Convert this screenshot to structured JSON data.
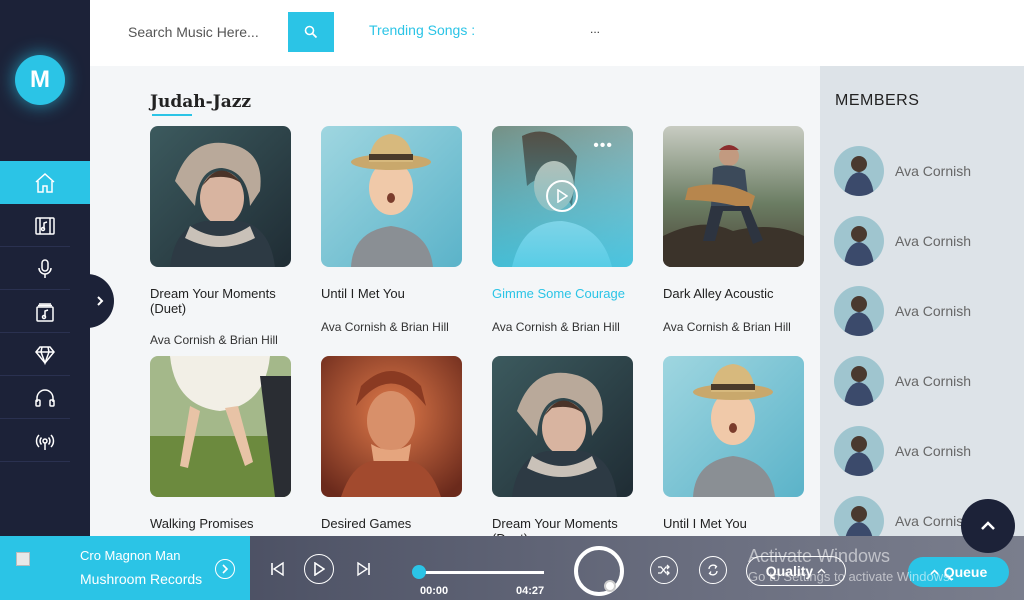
{
  "app": {
    "logo_letter": "M"
  },
  "sidebar": {
    "items": [
      {
        "icon": "home-icon",
        "active": true
      },
      {
        "icon": "music-library-icon",
        "active": false
      },
      {
        "icon": "microphone-icon",
        "active": false
      },
      {
        "icon": "album-icon",
        "active": false
      },
      {
        "icon": "diamond-icon",
        "active": false
      },
      {
        "icon": "headphones-icon",
        "active": false
      },
      {
        "icon": "broadcast-icon",
        "active": false
      }
    ]
  },
  "header": {
    "search_placeholder": "Search Music Here...",
    "trending_label": "Trending Songs :",
    "trending_value": "..."
  },
  "main": {
    "section_title": "Judah-Jazz",
    "cards": [
      {
        "title": "Dream Your Moments (Duet)",
        "artist": "Ava Cornish & Brian Hill"
      },
      {
        "title": "Until I Met You",
        "artist": "Ava Cornish & Brian Hill"
      },
      {
        "title": "Gimme Some Courage",
        "artist": "Ava Cornish & Brian Hill",
        "active": true
      },
      {
        "title": "Dark Alley Acoustic",
        "artist": "Ava Cornish & Brian Hill"
      },
      {
        "title": "Walking Promises",
        "artist": ""
      },
      {
        "title": "Desired Games",
        "artist": ""
      },
      {
        "title": "Dream Your Moments (Duet)",
        "artist": ""
      },
      {
        "title": "Until I Met You",
        "artist": ""
      }
    ]
  },
  "members": {
    "title": "MEMBERS",
    "list": [
      {
        "name": "Ava Cornish"
      },
      {
        "name": "Ava Cornish"
      },
      {
        "name": "Ava Cornish"
      },
      {
        "name": "Ava Cornish"
      },
      {
        "name": "Ava Cornish"
      },
      {
        "name": "Ava Cornish"
      }
    ]
  },
  "player": {
    "track_title": "Cro Magnon Man",
    "track_label": "Mushroom Records",
    "time_current": "00:00",
    "time_total": "04:27",
    "quality_label": "Quality",
    "queue_label": "Queue",
    "progress": 0
  },
  "watermark": {
    "line1": "Activate Windows",
    "line2": "Go to Settings to activate Windows."
  },
  "colors": {
    "accent": "#2bc4e6",
    "sidebar": "#1c2238"
  }
}
